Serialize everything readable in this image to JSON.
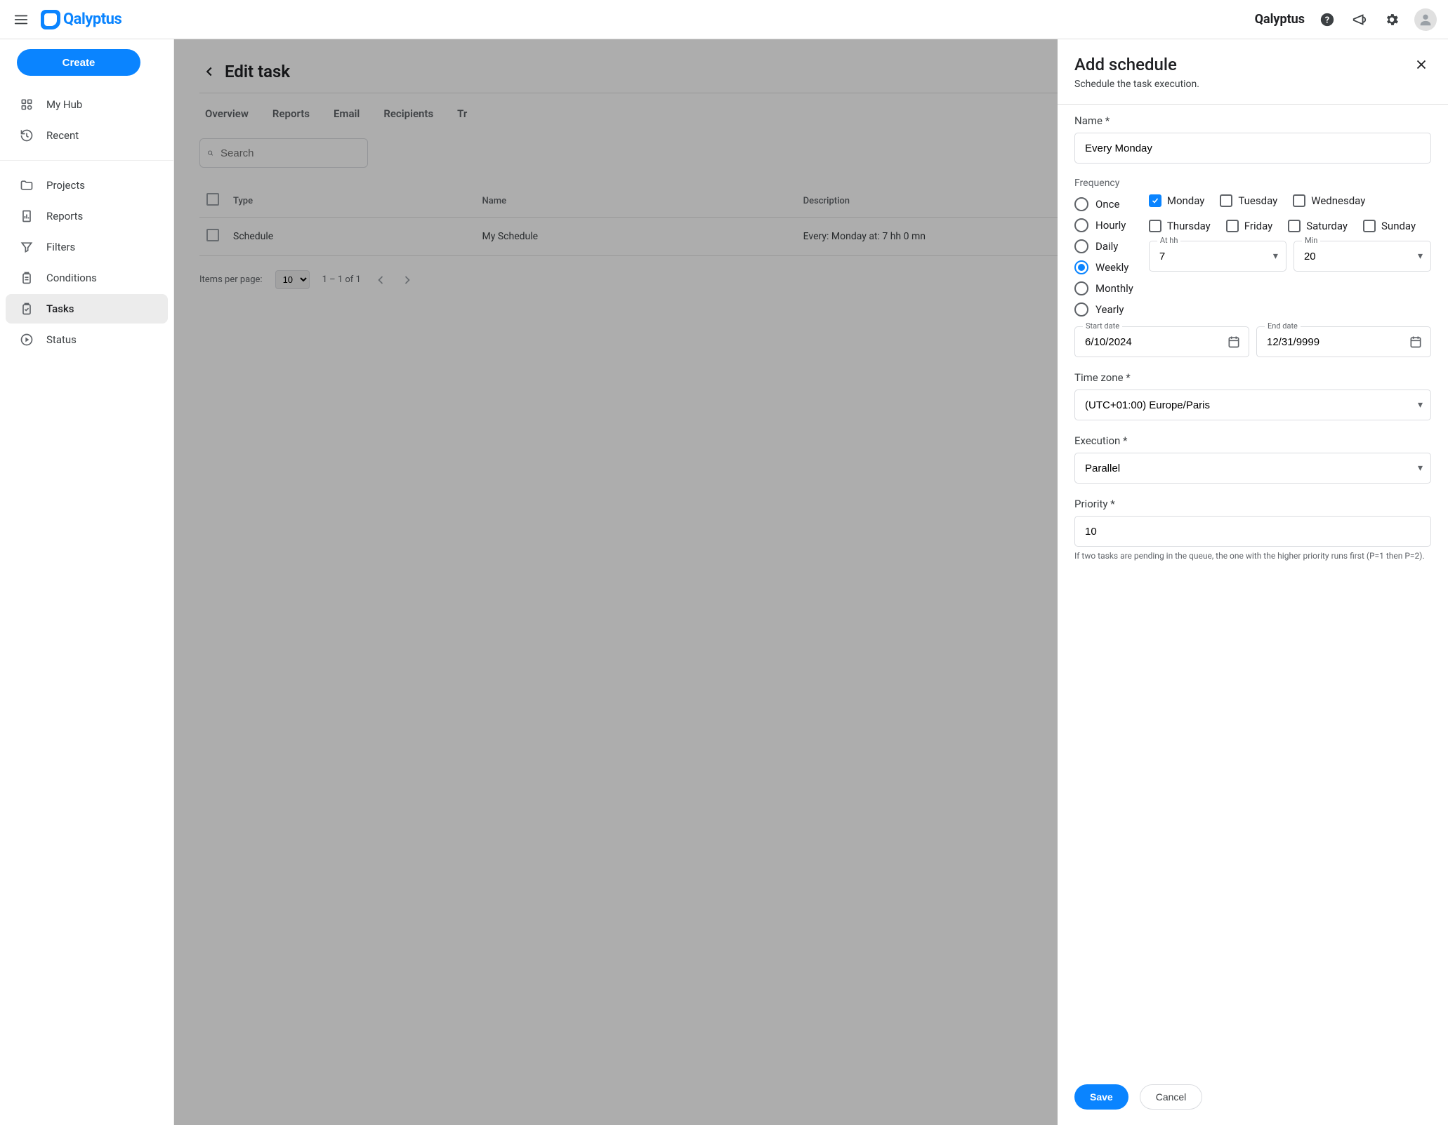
{
  "topbar": {
    "brand": "Qalyptus",
    "logo_text": "Qalyptus"
  },
  "sidebar": {
    "create_label": "Create",
    "items_top": [
      {
        "label": "My Hub",
        "icon": "hub"
      },
      {
        "label": "Recent",
        "icon": "recent"
      }
    ],
    "items_main": [
      {
        "label": "Projects",
        "icon": "folder"
      },
      {
        "label": "Reports",
        "icon": "report"
      },
      {
        "label": "Filters",
        "icon": "filter"
      },
      {
        "label": "Conditions",
        "icon": "clipboard"
      },
      {
        "label": "Tasks",
        "icon": "task",
        "active": true
      },
      {
        "label": "Status",
        "icon": "play"
      }
    ]
  },
  "page": {
    "title": "Edit task",
    "tabs": [
      "Overview",
      "Reports",
      "Email",
      "Recipients",
      "Tr"
    ],
    "search_placeholder": "Search",
    "columns": [
      "Type",
      "Name",
      "Description"
    ],
    "rows": [
      {
        "type": "Schedule",
        "name": "My Schedule",
        "description": "Every: Monday at: 7 hh 0 mn"
      }
    ],
    "pager": {
      "items_per_page_label": "Items per page:",
      "items_per_page_value": "10",
      "range": "1 – 1 of 1"
    }
  },
  "drawer": {
    "title": "Add schedule",
    "subtitle": "Schedule the task execution.",
    "name_label": "Name *",
    "name_value": "Every Monday",
    "frequency_label": "Frequency",
    "frequency_options": [
      "Once",
      "Hourly",
      "Daily",
      "Weekly",
      "Monthly",
      "Yearly"
    ],
    "frequency_selected": "Weekly",
    "days": [
      {
        "label": "Monday",
        "checked": true
      },
      {
        "label": "Tuesday",
        "checked": false
      },
      {
        "label": "Wednesday",
        "checked": false
      },
      {
        "label": "Thursday",
        "checked": false
      },
      {
        "label": "Friday",
        "checked": false
      },
      {
        "label": "Saturday",
        "checked": false
      },
      {
        "label": "Sunday",
        "checked": false
      }
    ],
    "at_hh_label": "At hh",
    "at_hh_value": "7",
    "min_label": "Min",
    "min_value": "20",
    "start_date_label": "Start date",
    "start_date_value": "6/10/2024",
    "end_date_label": "End date",
    "end_date_value": "12/31/9999",
    "timezone_label": "Time zone *",
    "timezone_value": "(UTC+01:00) Europe/Paris",
    "execution_label": "Execution *",
    "execution_value": "Parallel",
    "priority_label": "Priority *",
    "priority_value": "10",
    "priority_hint": "If two tasks are pending in the queue, the one with the higher priority runs first (P=1 then P=2).",
    "save_label": "Save",
    "cancel_label": "Cancel"
  }
}
